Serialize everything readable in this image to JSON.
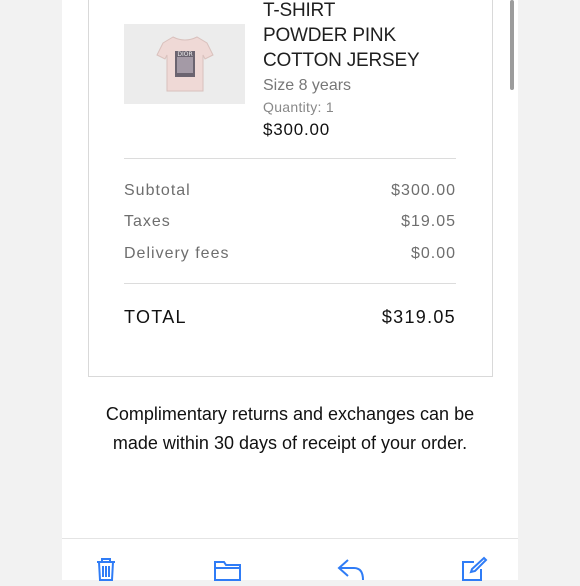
{
  "product": {
    "name_lines": [
      "T-SHIRT",
      "POWDER PINK",
      "COTTON JERSEY"
    ],
    "size": "Size 8 years",
    "quantity": "Quantity: 1",
    "price": "$300.00",
    "image_icon": "t-shirt-thumbnail"
  },
  "summary": {
    "subtotal_label": "Subtotal",
    "subtotal_value": "$300.00",
    "taxes_label": "Taxes",
    "taxes_value": "$19.05",
    "delivery_label": "Delivery fees",
    "delivery_value": "$0.00",
    "total_label": "TOTAL",
    "total_value": "$319.05"
  },
  "notice": "Complimentary returns and exchanges can be made within 30 days of receipt of your order.",
  "toolbar": {
    "icons": [
      "trash-icon",
      "folder-icon",
      "reply-icon",
      "compose-icon"
    ],
    "accent_color": "#2f7cf6"
  }
}
